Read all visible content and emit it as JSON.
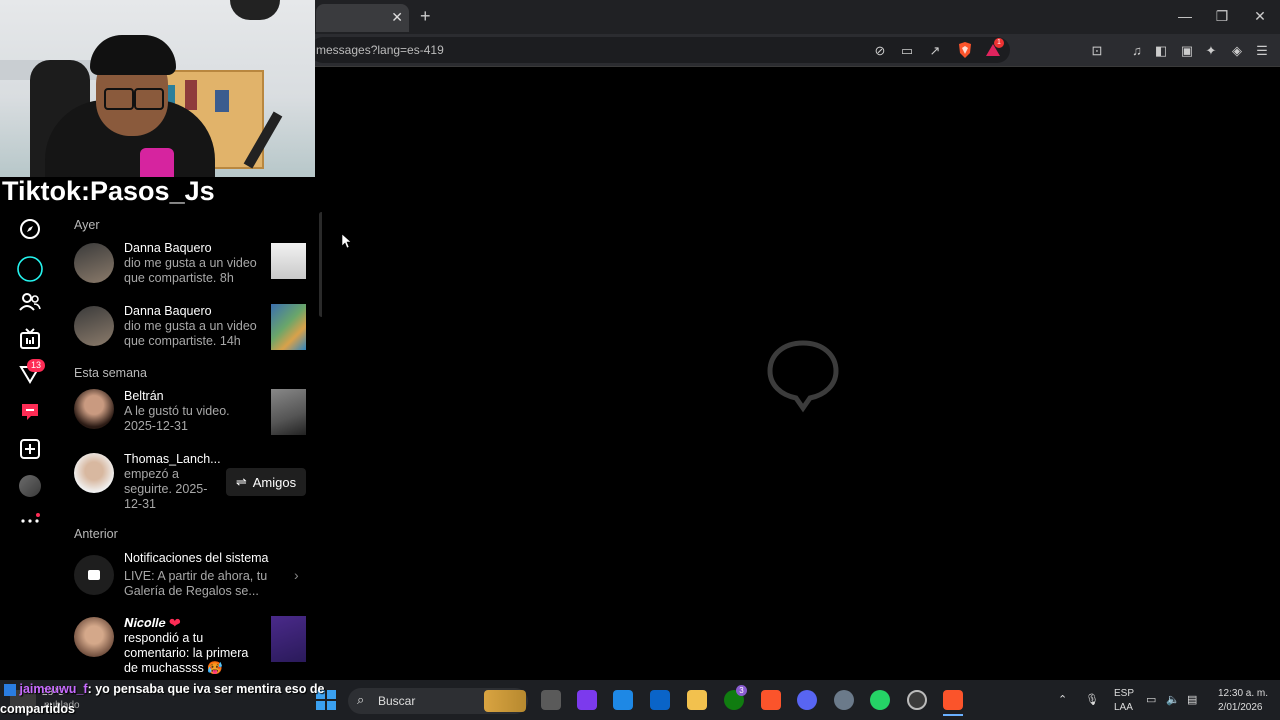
{
  "browser": {
    "url": "messages?lang=es-419",
    "new_tab_symbol": "+",
    "close_tab_symbol": "✕",
    "shields_count": "",
    "alert_badge": "1"
  },
  "overlay": {
    "caption": "Tiktok:Pasos_Js"
  },
  "sidebar": {
    "notif_badge": "13"
  },
  "notifications": {
    "sections": {
      "ayer": "Ayer",
      "semana": "Esta semana",
      "anterior": "Anterior"
    },
    "items": [
      {
        "name": "Danna Baquero",
        "line1": "dio me gusta a un video",
        "line2": "que compartiste. 8h"
      },
      {
        "name": "Danna Baquero",
        "line1": "dio me gusta a un video",
        "line2": "que compartiste. 14h"
      },
      {
        "name": "Beltrán",
        "line1": "A le gustó tu video.",
        "line2": "2025-12-31"
      },
      {
        "name": "Thomas_Lanch...",
        "line1": "empezó a",
        "line2": "seguirte. 2025-",
        "line3": "12-31",
        "button": "Amigos"
      },
      {
        "name": "Notificaciones del sistema",
        "line1": "LIVE: A partir de ahora, tu",
        "line2": "Galería de Regalos se..."
      },
      {
        "name": "𝑵𝒊𝒄𝒐𝒍𝒍𝒆",
        "line1": "respondió a tu",
        "line2": "comentario: la primera",
        "line3": "de muchassss 🥵"
      }
    ]
  },
  "chat": {
    "user": "jaimeuwu_f",
    "message": ": yo pensaba que iva ser mentira eso de compartidos"
  },
  "taskbar": {
    "weather": "nublado",
    "weather_temp": "28°C",
    "search_placeholder": "Buscar",
    "lang1": "ESP",
    "lang2": "LAA",
    "time": "12:30 a. m.",
    "date": "2/01/2026",
    "xbox_badge": "3"
  },
  "colors": {
    "tiktok_red": "#fe2c55",
    "chrome_bg": "#202124",
    "taskbar_bg": "#1d1f23"
  }
}
